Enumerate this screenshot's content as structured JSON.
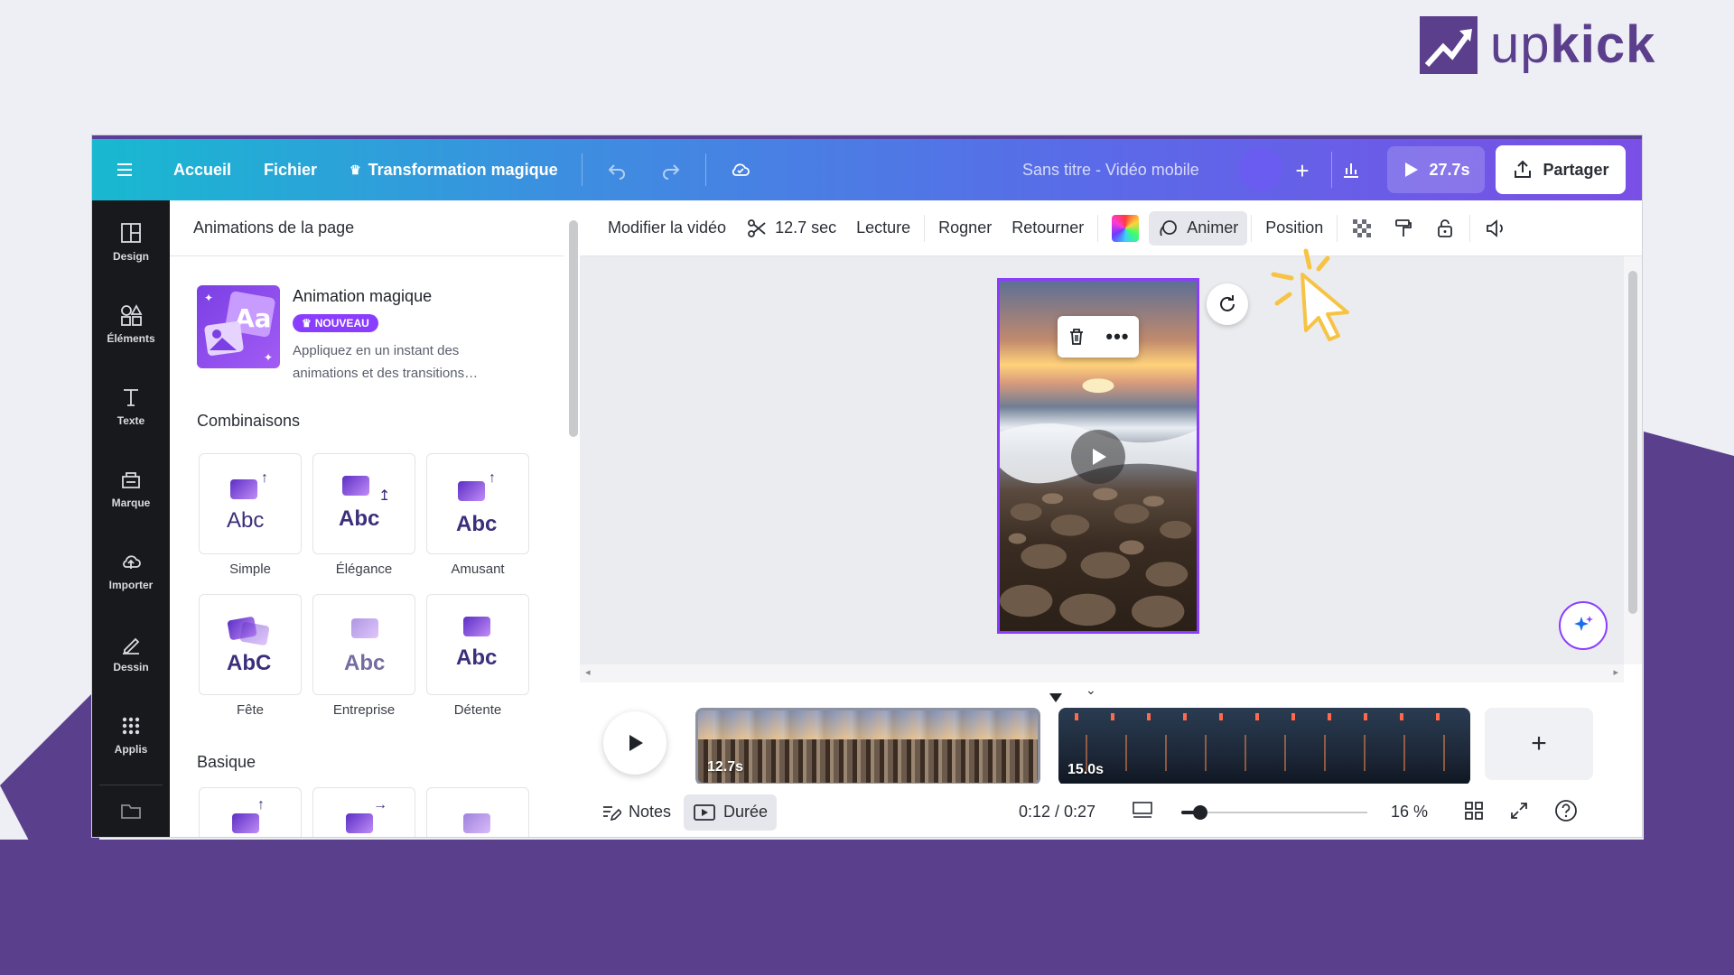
{
  "brand": {
    "logo_text_light": "up",
    "logo_text_bold": "kick",
    "brand_color": "#5b3f8c"
  },
  "topbar": {
    "menu_icon": "hamburger-icon",
    "home": "Accueil",
    "file": "Fichier",
    "magic": "Transformation magique",
    "title": "Sans titre - Vidéo mobile",
    "play_duration": "27.7s",
    "share": "Partager"
  },
  "rail": [
    {
      "label": "Design",
      "icon": "layout-icon"
    },
    {
      "label": "Éléments",
      "icon": "shapes-icon"
    },
    {
      "label": "Texte",
      "icon": "text-icon"
    },
    {
      "label": "Marque",
      "icon": "brand-icon"
    },
    {
      "label": "Importer",
      "icon": "upload-icon"
    },
    {
      "label": "Dessin",
      "icon": "draw-icon"
    },
    {
      "label": "Applis",
      "icon": "apps-icon"
    }
  ],
  "panel": {
    "title": "Animations de la page",
    "magic": {
      "title": "Animation magique",
      "badge": "NOUVEAU",
      "desc_line1": "Appliquez en un instant des",
      "desc_line2": "animations et des transitions…"
    },
    "section_combinations": "Combinaisons",
    "section_basic": "Basique",
    "combinations": [
      {
        "label": "Simple",
        "sample": "Abc"
      },
      {
        "label": "Élégance",
        "sample": "Abc"
      },
      {
        "label": "Amusant",
        "sample": "Abc"
      },
      {
        "label": "Fête",
        "sample": "AbC"
      },
      {
        "label": "Entreprise",
        "sample": "Abc"
      },
      {
        "label": "Détente",
        "sample": "Abc"
      }
    ]
  },
  "toolbar": {
    "edit_video": "Modifier la vidéo",
    "duration": "12.7 sec",
    "playback": "Lecture",
    "crop": "Rogner",
    "flip": "Retourner",
    "animate": "Animer",
    "position": "Position"
  },
  "timeline": {
    "clip1_label": "12.7s",
    "clip2_label": "15.0s"
  },
  "bottombar": {
    "notes": "Notes",
    "duration": "Durée",
    "time": "0:12 / 0:27",
    "zoom": "16 %",
    "zoom_level": 0.1
  },
  "colors": {
    "accent": "#8b3dff",
    "cursor": "#f6c344"
  }
}
